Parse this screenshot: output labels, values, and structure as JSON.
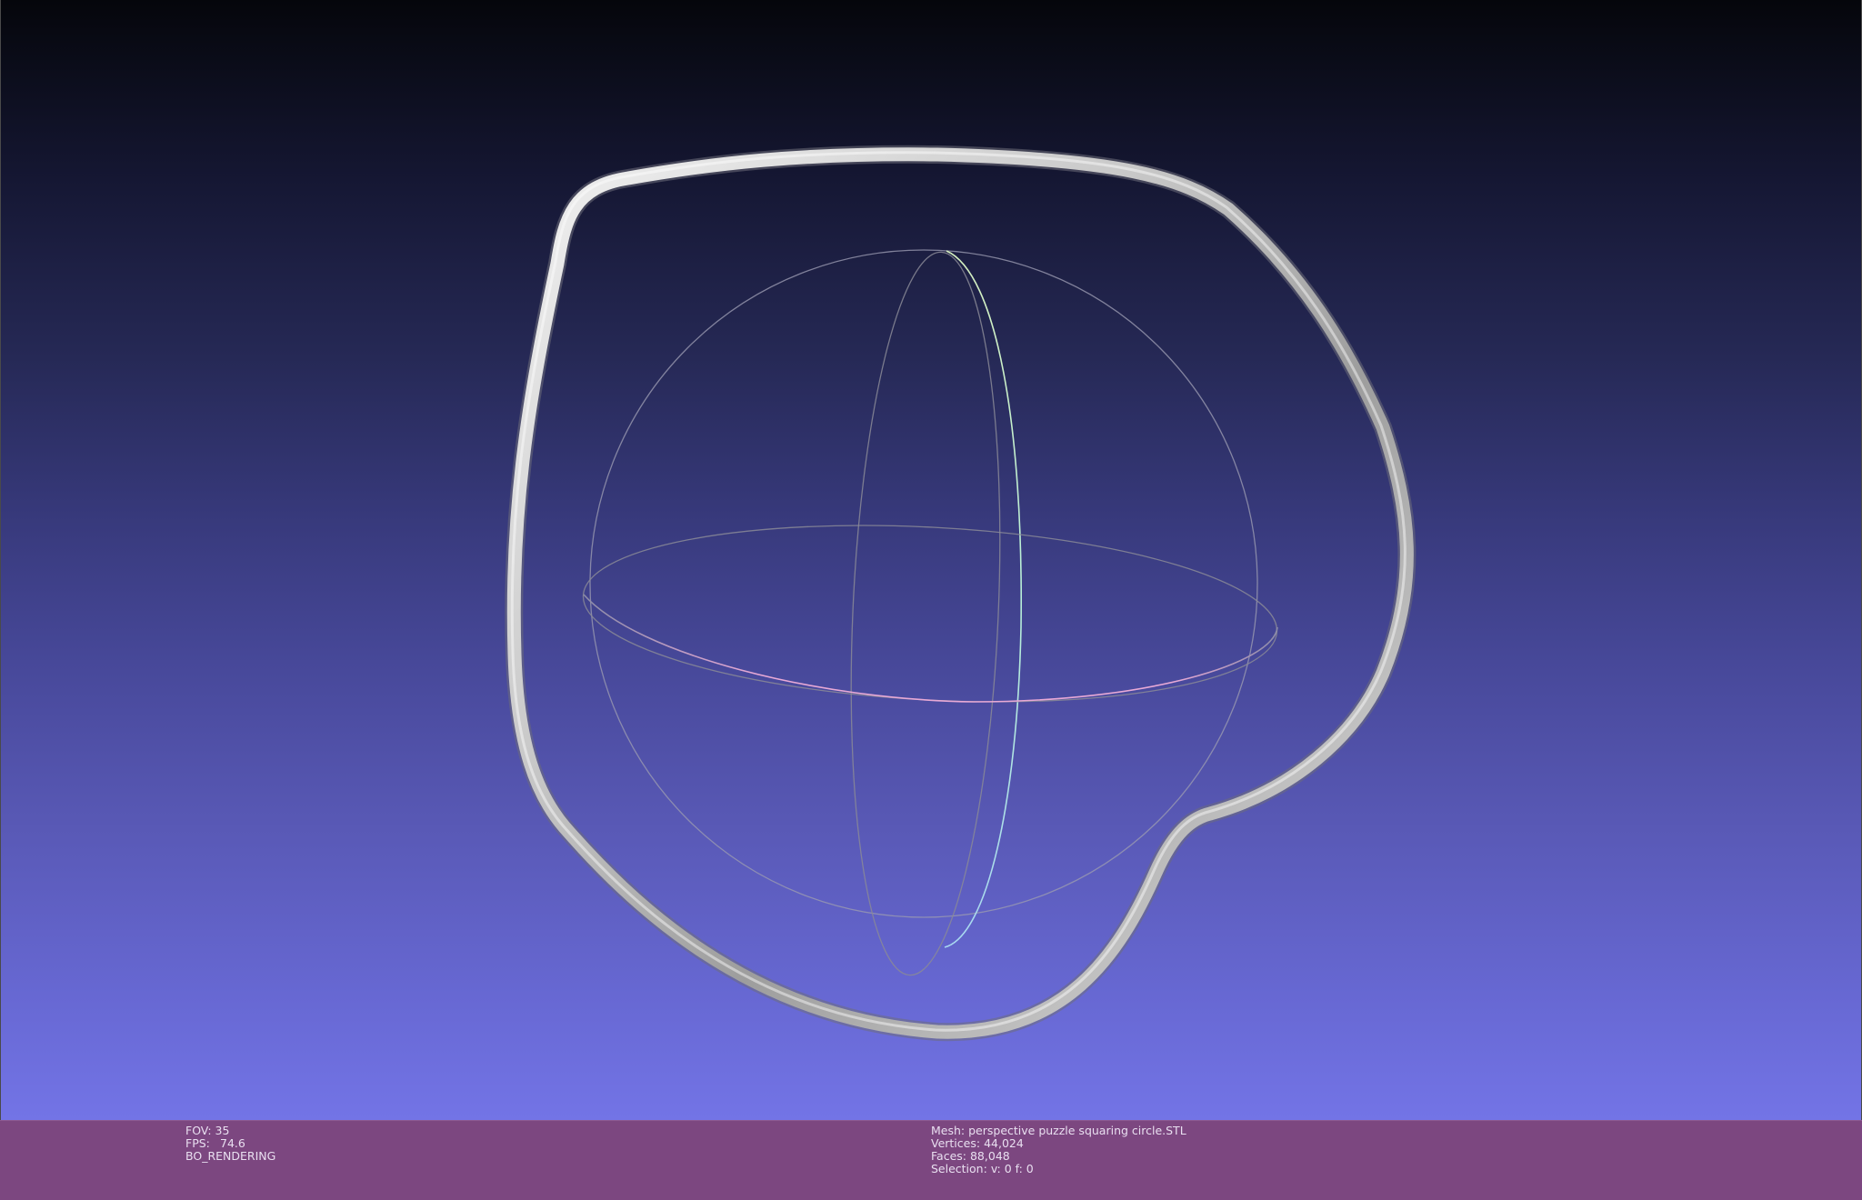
{
  "viewport": {
    "render_info": {
      "fov_label": "FOV:",
      "fov_value": "35",
      "fps_label": "FPS:",
      "fps_value": "74.6",
      "mode": "BO_RENDERING"
    },
    "mesh_info": {
      "mesh_label": "Mesh:",
      "mesh_name": "perspective puzzle squaring circle.STL",
      "vertices_label": "Vertices:",
      "vertices": "44,024",
      "faces_label": "Faces:",
      "faces": "88,048",
      "selection_label": "Selection:",
      "selection": "v: 0 f: 0"
    }
  },
  "colors": {
    "background_top": "#05060b",
    "background_bottom": "#7374e6",
    "status_bar": "#7c4780",
    "trackball_x_axis": "#e8a9d6",
    "trackball_y_axis": "#b8f0d8",
    "trackball_z_axis": "#9a9ab0",
    "mesh": "#c8c8c8"
  }
}
